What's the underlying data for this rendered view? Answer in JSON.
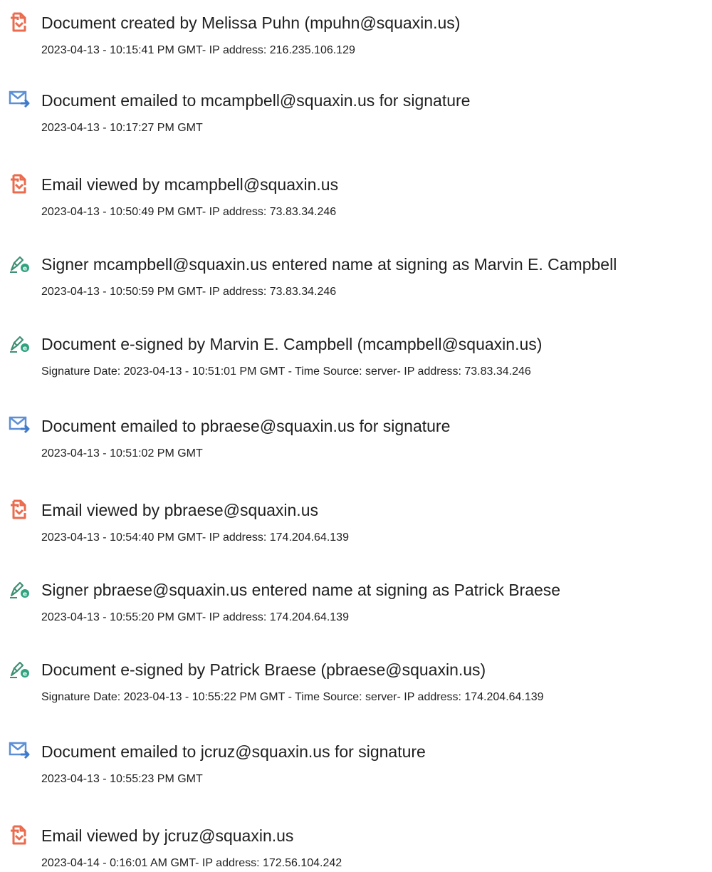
{
  "entries": [
    {
      "icon": "document-viewed-icon",
      "title": "Document created by Melissa Puhn (mpuhn@squaxin.us)",
      "detail": "2023-04-13 - 10:15:41 PM GMT- IP address: 216.235.106.129"
    },
    {
      "icon": "email-sent-icon",
      "title": "Document emailed to mcampbell@squaxin.us for signature",
      "detail": "2023-04-13 - 10:17:27 PM GMT"
    },
    {
      "icon": "document-viewed-icon",
      "title": "Email viewed by mcampbell@squaxin.us",
      "detail": "2023-04-13 - 10:50:49 PM GMT- IP address: 73.83.34.246"
    },
    {
      "icon": "esign-pen-icon",
      "title": "Signer mcampbell@squaxin.us entered name at signing as Marvin E. Campbell",
      "detail": "2023-04-13 - 10:50:59 PM GMT- IP address: 73.83.34.246"
    },
    {
      "icon": "esign-pen-icon",
      "title": "Document e-signed by Marvin E. Campbell (mcampbell@squaxin.us)",
      "detail": "Signature Date: 2023-04-13 - 10:51:01 PM GMT - Time Source: server- IP address: 73.83.34.246"
    },
    {
      "icon": "email-sent-icon",
      "title": "Document emailed to pbraese@squaxin.us for signature",
      "detail": "2023-04-13 - 10:51:02 PM GMT"
    },
    {
      "icon": "document-viewed-icon",
      "title": "Email viewed by pbraese@squaxin.us",
      "detail": "2023-04-13 - 10:54:40 PM GMT- IP address: 174.204.64.139"
    },
    {
      "icon": "esign-pen-icon",
      "title": "Signer pbraese@squaxin.us entered name at signing as Patrick Braese",
      "detail": "2023-04-13 - 10:55:20 PM GMT- IP address: 174.204.64.139"
    },
    {
      "icon": "esign-pen-icon",
      "title": "Document e-signed by Patrick Braese (pbraese@squaxin.us)",
      "detail": "Signature Date: 2023-04-13 - 10:55:22 PM GMT - Time Source: server- IP address: 174.204.64.139"
    },
    {
      "icon": "email-sent-icon",
      "title": "Document emailed to jcruz@squaxin.us for signature",
      "detail": "2023-04-13 - 10:55:23 PM GMT"
    },
    {
      "icon": "document-viewed-icon",
      "title": "Email viewed by jcruz@squaxin.us",
      "detail": "2023-04-14 - 0:16:01 AM GMT- IP address: 172.56.104.242"
    }
  ],
  "colors": {
    "doc_icon": "#ea6b4e",
    "email_icon": "#5b8fd6",
    "email_arrow": "#3f7bcc",
    "pen_icon": "#3e8f73",
    "pen_badge": "#2fa37f",
    "text": "#1f1f1f"
  }
}
